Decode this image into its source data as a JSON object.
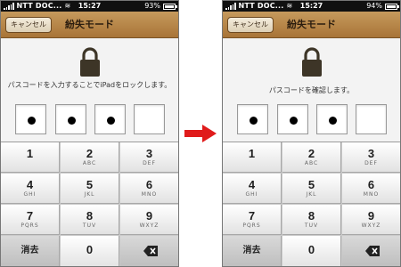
{
  "screens": [
    {
      "status": {
        "carrier": "NTT DOC...",
        "time": "15:27",
        "battery": "93%"
      },
      "nav": {
        "cancel": "キャンセル",
        "title": "紛失モード"
      },
      "message": "パスコードを入力することでiPadをロックします。",
      "pin_filled": 3,
      "pin_total": 4
    },
    {
      "status": {
        "carrier": "NTT DOC...",
        "time": "15:27",
        "battery": "94%"
      },
      "nav": {
        "cancel": "キャンセル",
        "title": "紛失モード"
      },
      "message": "パスコードを確認します。",
      "pin_filled": 3,
      "pin_total": 4
    }
  ],
  "keypad": {
    "keys": [
      {
        "digit": "1",
        "letters": ""
      },
      {
        "digit": "2",
        "letters": "ABC"
      },
      {
        "digit": "3",
        "letters": "DEF"
      },
      {
        "digit": "4",
        "letters": "GHI"
      },
      {
        "digit": "5",
        "letters": "JKL"
      },
      {
        "digit": "6",
        "letters": "MNO"
      },
      {
        "digit": "7",
        "letters": "PQRS"
      },
      {
        "digit": "8",
        "letters": "TUV"
      },
      {
        "digit": "9",
        "letters": "WXYZ"
      }
    ],
    "clear_label": "消去",
    "zero": "0"
  },
  "colors": {
    "navbar": "#b5864a",
    "arrow": "#e01b1b",
    "keypad_bg": "#c9c9c9"
  },
  "icons": {
    "lock": "padlock-icon",
    "backspace": "backspace-icon",
    "arrow": "right-arrow-icon"
  }
}
